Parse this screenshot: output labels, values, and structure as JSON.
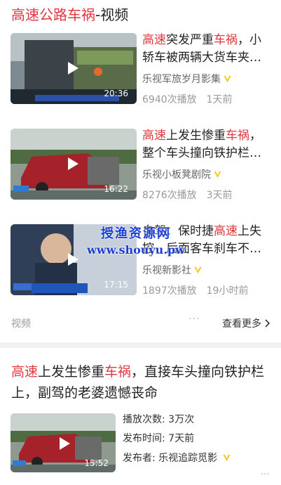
{
  "section": {
    "title_highlight": "高速公路车祸",
    "title_suffix": "-视频"
  },
  "videos": [
    {
      "title_parts": [
        {
          "text": "高速",
          "hl": true
        },
        {
          "text": "突发严重",
          "hl": false
        },
        {
          "text": "车祸",
          "hl": true
        },
        {
          "text": "，小轿车被两辆大货车夹…",
          "hl": false
        }
      ],
      "source": "乐视军旅岁月影集",
      "plays": "6940次播放",
      "time": "1天前",
      "duration": "20:36"
    },
    {
      "title_parts": [
        {
          "text": "高速",
          "hl": true
        },
        {
          "text": "上发生惨重",
          "hl": false
        },
        {
          "text": "车祸",
          "hl": true
        },
        {
          "text": "，整个车头撞向铁护栏…",
          "hl": false
        }
      ],
      "source": "乐视小板凳剧院",
      "plays": "8276次播放",
      "time": "3天前",
      "duration": "16:22"
    },
    {
      "title_parts": [
        {
          "text": "自驾：保时捷",
          "hl": false
        },
        {
          "text": "高速",
          "hl": true
        },
        {
          "text": "上失控，后面客车刹车不…",
          "hl": false
        }
      ],
      "source": "乐视新影社",
      "plays": "1897次播放",
      "time": "19小时前",
      "duration": "17:15"
    }
  ],
  "footer": {
    "label": "视频",
    "dots": "···",
    "more": "查看更多"
  },
  "feature": {
    "title_parts": [
      {
        "text": "高速",
        "hl": true
      },
      {
        "text": "上发生惨重",
        "hl": false
      },
      {
        "text": "车祸",
        "hl": true
      },
      {
        "text": "，直接车头撞向铁护栏上，副驾的老婆遗憾丧命",
        "hl": false
      }
    ],
    "plays_label": "播放次数:",
    "plays_value": "3万次",
    "time_label": "发布时间:",
    "time_value": "7天前",
    "author_label": "发布者:",
    "author_value": "乐视追踪觅影",
    "duration": "15:52",
    "dots": "···"
  },
  "watermark": {
    "line1": "授渔资源网",
    "line2": "www.shouyu.pw"
  },
  "colors": {
    "highlight": "#e0383e",
    "verified_badge": "#f5c518"
  }
}
